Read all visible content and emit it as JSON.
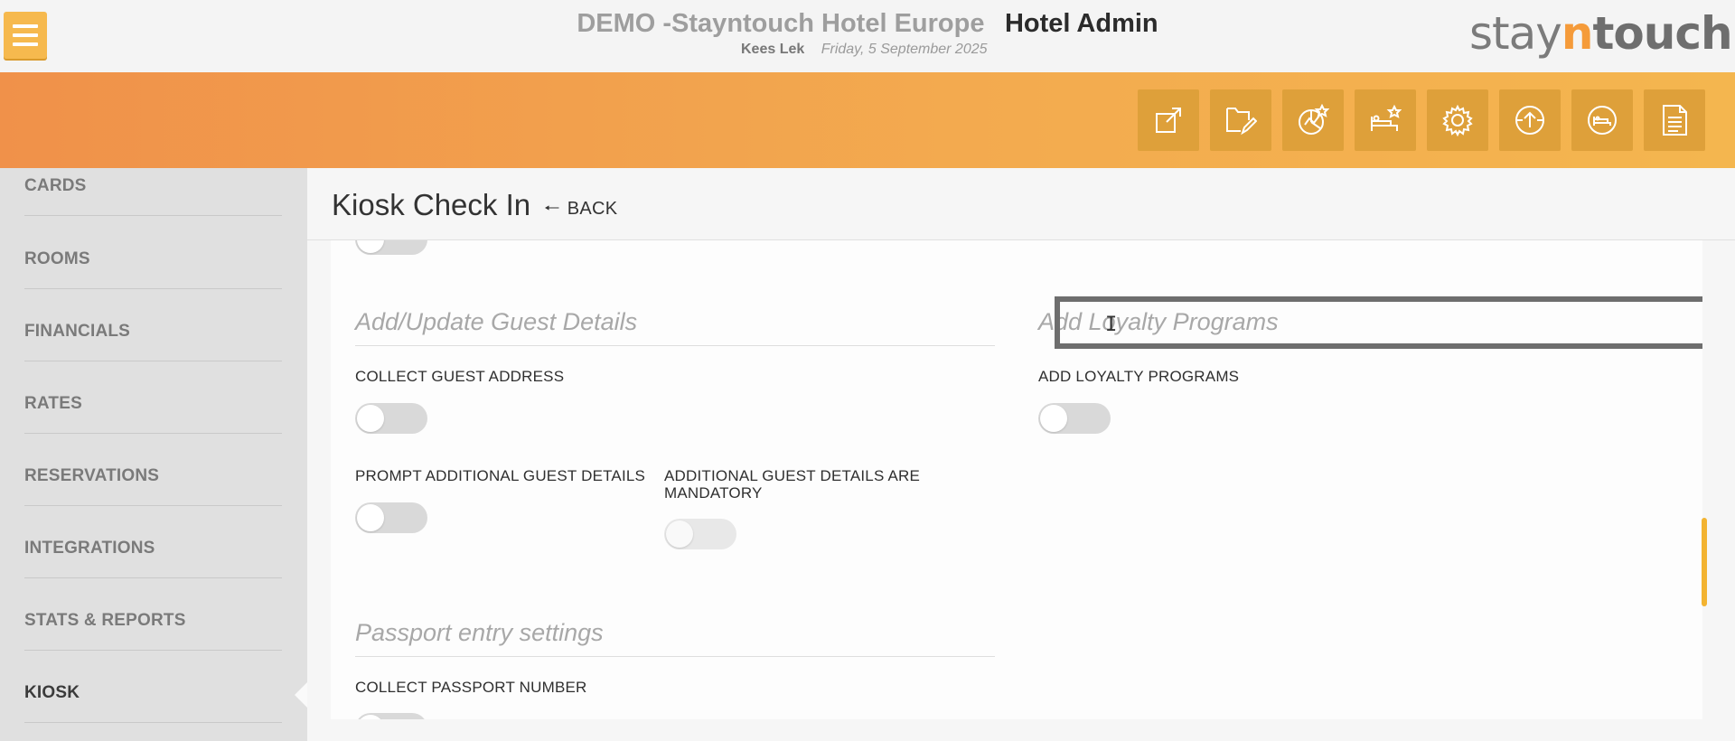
{
  "header": {
    "hotel_name": "DEMO -Stayntouch Hotel Europe",
    "module_name": "Hotel Admin",
    "user_name": "Kees Lek",
    "date": "Friday, 5 September 2025",
    "logo": {
      "part1": "stay",
      "part2": "n",
      "part3": "touch"
    }
  },
  "toolbar": {
    "icons": [
      "external-link-icon",
      "folder-edit-icon",
      "chart-star-icon",
      "bed-star-icon",
      "gear-icon",
      "upload-icon",
      "bed-icon",
      "document-icon"
    ]
  },
  "sidebar": {
    "items": [
      {
        "label": "CARDS",
        "active": false
      },
      {
        "label": "ROOMS",
        "active": false
      },
      {
        "label": "FINANCIALS",
        "active": false
      },
      {
        "label": "RATES",
        "active": false
      },
      {
        "label": "RESERVATIONS",
        "active": false
      },
      {
        "label": "INTEGRATIONS",
        "active": false
      },
      {
        "label": "STATS & REPORTS",
        "active": false
      },
      {
        "label": "KIOSK",
        "active": true
      }
    ]
  },
  "page": {
    "title": "Kiosk Check In",
    "back_label": "BACK"
  },
  "sections": {
    "guest_details": {
      "title": "Add/Update Guest Details",
      "collect_address": {
        "label": "COLLECT GUEST ADDRESS",
        "on": false
      },
      "prompt_additional": {
        "label": "PROMPT ADDITIONAL GUEST DETAILS",
        "on": false
      },
      "additional_mandatory": {
        "label": "ADDITIONAL GUEST DETAILS ARE MANDATORY",
        "on": false
      }
    },
    "loyalty": {
      "title": "Add Loyalty Programs",
      "add_loyalty": {
        "label": "ADD LOYALTY PROGRAMS",
        "on": false
      }
    },
    "passport": {
      "title": "Passport entry settings",
      "collect_passport": {
        "label": "COLLECT PASSPORT NUMBER",
        "on": false
      }
    }
  },
  "colors": {
    "accent": "#f6b94e",
    "band_start": "#f0914a",
    "band_end": "#f4b64f",
    "tool_bg": "#dea03a",
    "scrollbar": "#f3b330"
  }
}
